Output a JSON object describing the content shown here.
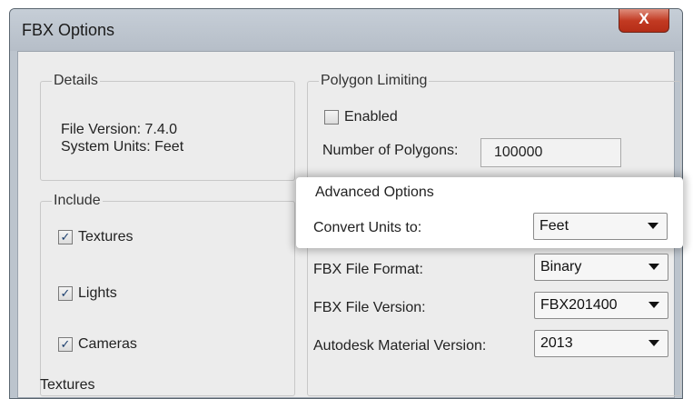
{
  "window": {
    "title": "FBX Options",
    "close_label": "X"
  },
  "details": {
    "title": "Details",
    "file_version": "File Version: 7.4.0",
    "system_units": "System Units: Feet"
  },
  "polygon_limiting": {
    "title": "Polygon Limiting",
    "enabled_label": "Enabled",
    "enabled_checked": false,
    "num_polygons_label": "Number of Polygons:",
    "num_polygons_value": "100000"
  },
  "include": {
    "title": "Include",
    "textures_label": "Textures",
    "lights_label": "Lights",
    "cameras_label": "Cameras",
    "check_mark": "✓"
  },
  "advanced": {
    "title": "Advanced Options",
    "convert_units_label": "Convert Units to:",
    "convert_units_value": "Feet",
    "file_format_label": "FBX File Format:",
    "file_format_value": "Binary",
    "file_version_label": "FBX File Version:",
    "file_version_value": "FBX201400",
    "material_version_label": "Autodesk Material Version:",
    "material_version_value": "2013"
  },
  "partial_bottom_label": "Textures"
}
